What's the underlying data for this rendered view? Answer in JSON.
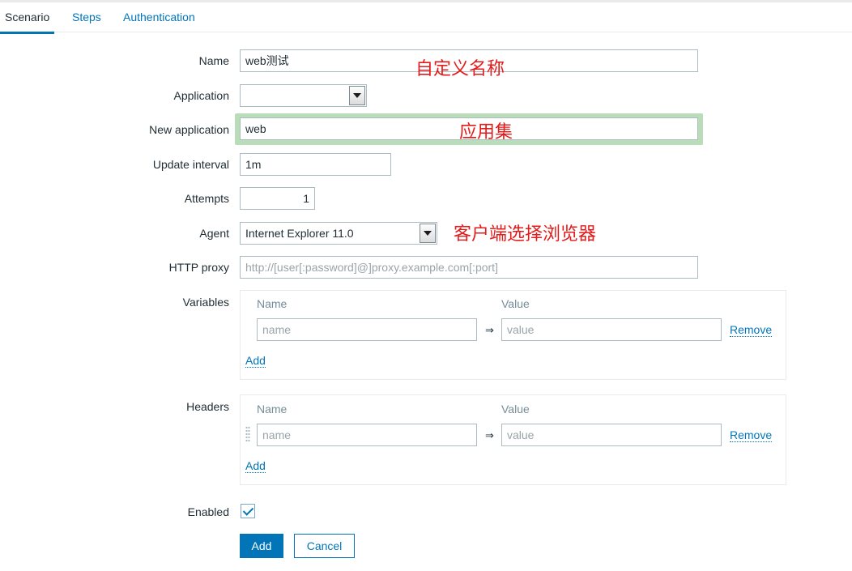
{
  "tabs": [
    {
      "label": "Scenario",
      "active": true
    },
    {
      "label": "Steps",
      "active": false
    },
    {
      "label": "Authentication",
      "active": false
    }
  ],
  "form": {
    "name": {
      "label": "Name",
      "value": "web测试"
    },
    "application": {
      "label": "Application",
      "value": ""
    },
    "new_application": {
      "label": "New application",
      "value": "web"
    },
    "update_interval": {
      "label": "Update interval",
      "value": "1m"
    },
    "attempts": {
      "label": "Attempts",
      "value": "1"
    },
    "agent": {
      "label": "Agent",
      "value": "Internet Explorer 11.0"
    },
    "http_proxy": {
      "label": "HTTP proxy",
      "placeholder": "http://[user[:password]@]proxy.example.com[:port]"
    },
    "variables": {
      "label": "Variables",
      "col_name": "Name",
      "col_value": "Value",
      "rows": [
        {
          "name_placeholder": "name",
          "value_placeholder": "value",
          "arrow": "⇒",
          "remove": "Remove"
        }
      ],
      "add": "Add"
    },
    "headers": {
      "label": "Headers",
      "col_name": "Name",
      "col_value": "Value",
      "rows": [
        {
          "name_placeholder": "name",
          "value_placeholder": "value",
          "arrow": "⇒",
          "remove": "Remove"
        }
      ],
      "add": "Add"
    },
    "enabled": {
      "label": "Enabled",
      "checked": true
    },
    "buttons": {
      "add": "Add",
      "cancel": "Cancel"
    }
  },
  "annotations": {
    "name_note": "自定义名称",
    "app_note": "应用集",
    "agent_note": "客户端选择浏览器"
  },
  "colors": {
    "accent": "#0275b8",
    "annotation": "#e41b1b",
    "highlight": "#b9dcb9"
  }
}
